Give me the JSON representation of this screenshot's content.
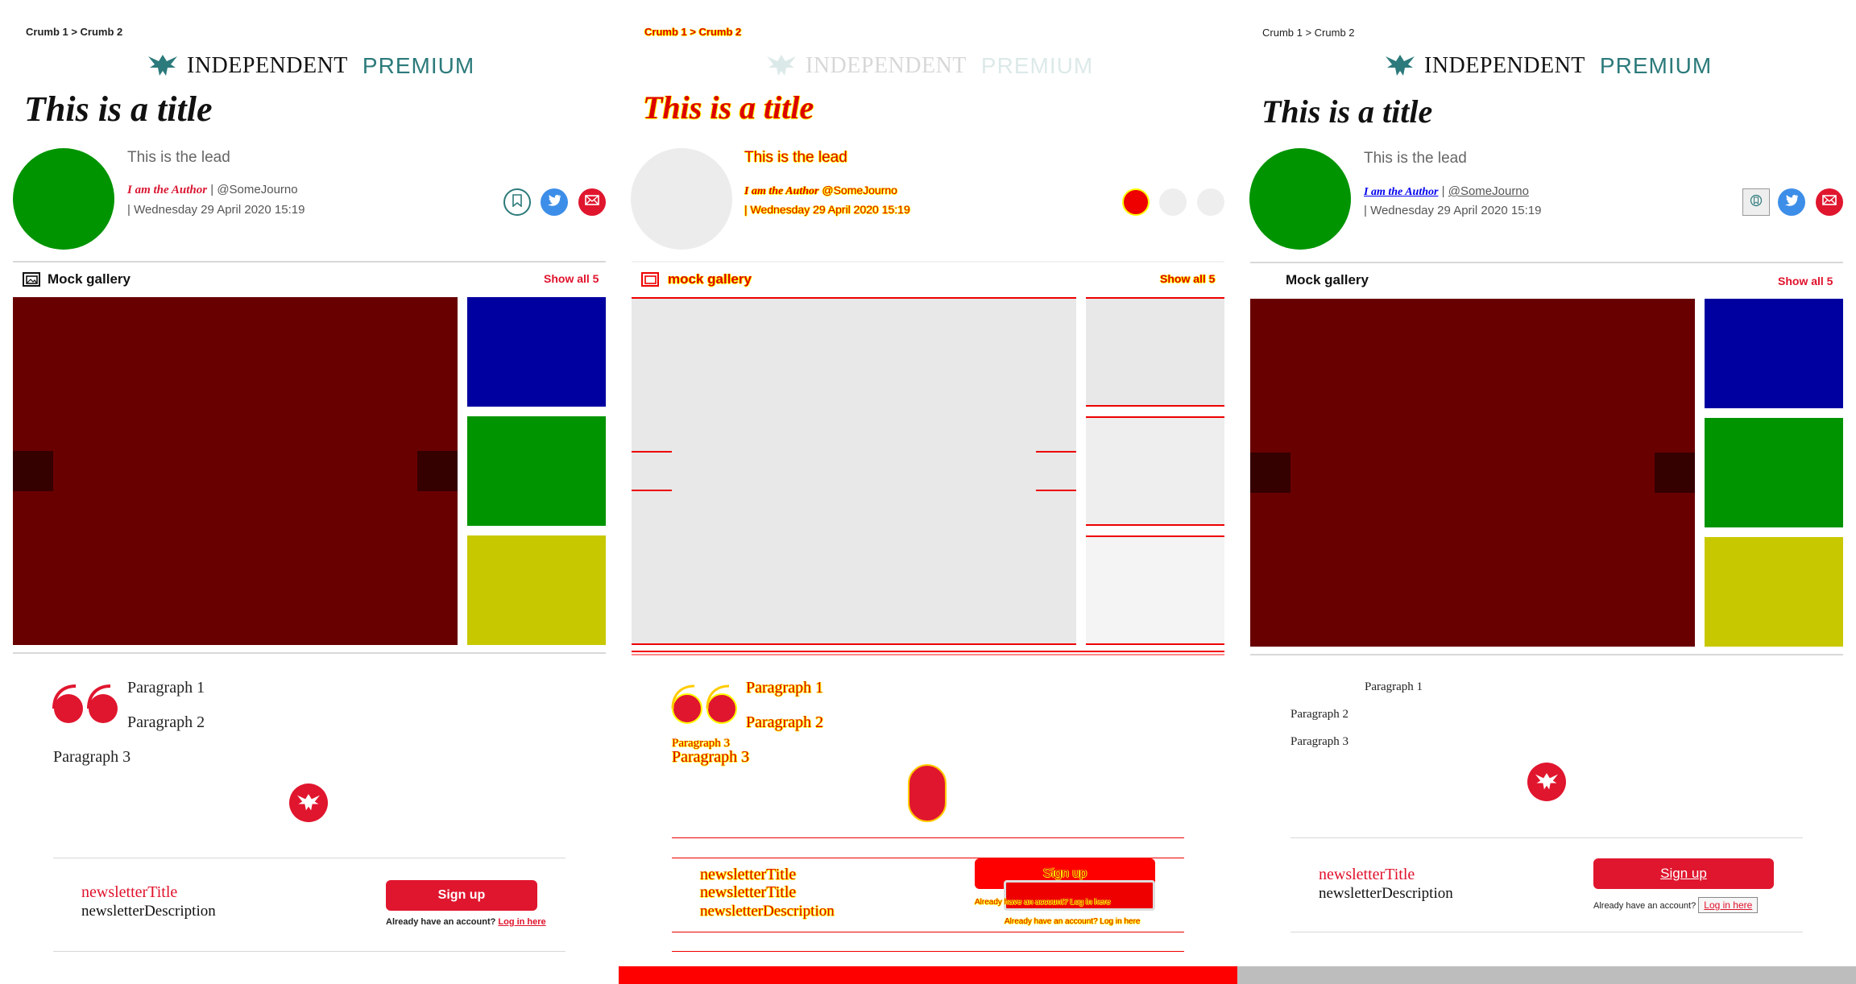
{
  "breadcrumb": "Crumb 1 > Crumb 2",
  "logo": {
    "brand": "INDEPENDENT",
    "tier": "PREMIUM"
  },
  "article": {
    "title": "This is a title",
    "lead": "This is the lead",
    "author": "I am the Author",
    "separator": "|",
    "handle": "@SomeJourno",
    "date": "| Wednesday 29 April 2020 15:19"
  },
  "gallery": {
    "label": "Mock gallery",
    "label_diff": "mock gallery",
    "show_all": "Show all 5"
  },
  "paragraphs": [
    "Paragraph 1",
    "Paragraph 2",
    "Paragraph 3"
  ],
  "newsletter": {
    "title": "newsletterTitle",
    "description": "newsletterDescription",
    "signup": "Sign up",
    "account_text": "Already have an account?",
    "login": "Log in here"
  },
  "icons": [
    "eagle-logo-icon",
    "bookmark-icon",
    "twitter-icon",
    "email-icon",
    "gallery-icon",
    "quote-icon",
    "independent-eagle-icon"
  ],
  "colors": {
    "brand_red": "#e0162e",
    "premium_teal": "#2c7a7b",
    "author_circle": "#009400",
    "gallery_main": "#690000",
    "gallery_blue": "#0000a0",
    "gallery_green": "#009400",
    "gallery_yellow": "#c8c800",
    "twitter_blue": "#3d8ee8"
  }
}
